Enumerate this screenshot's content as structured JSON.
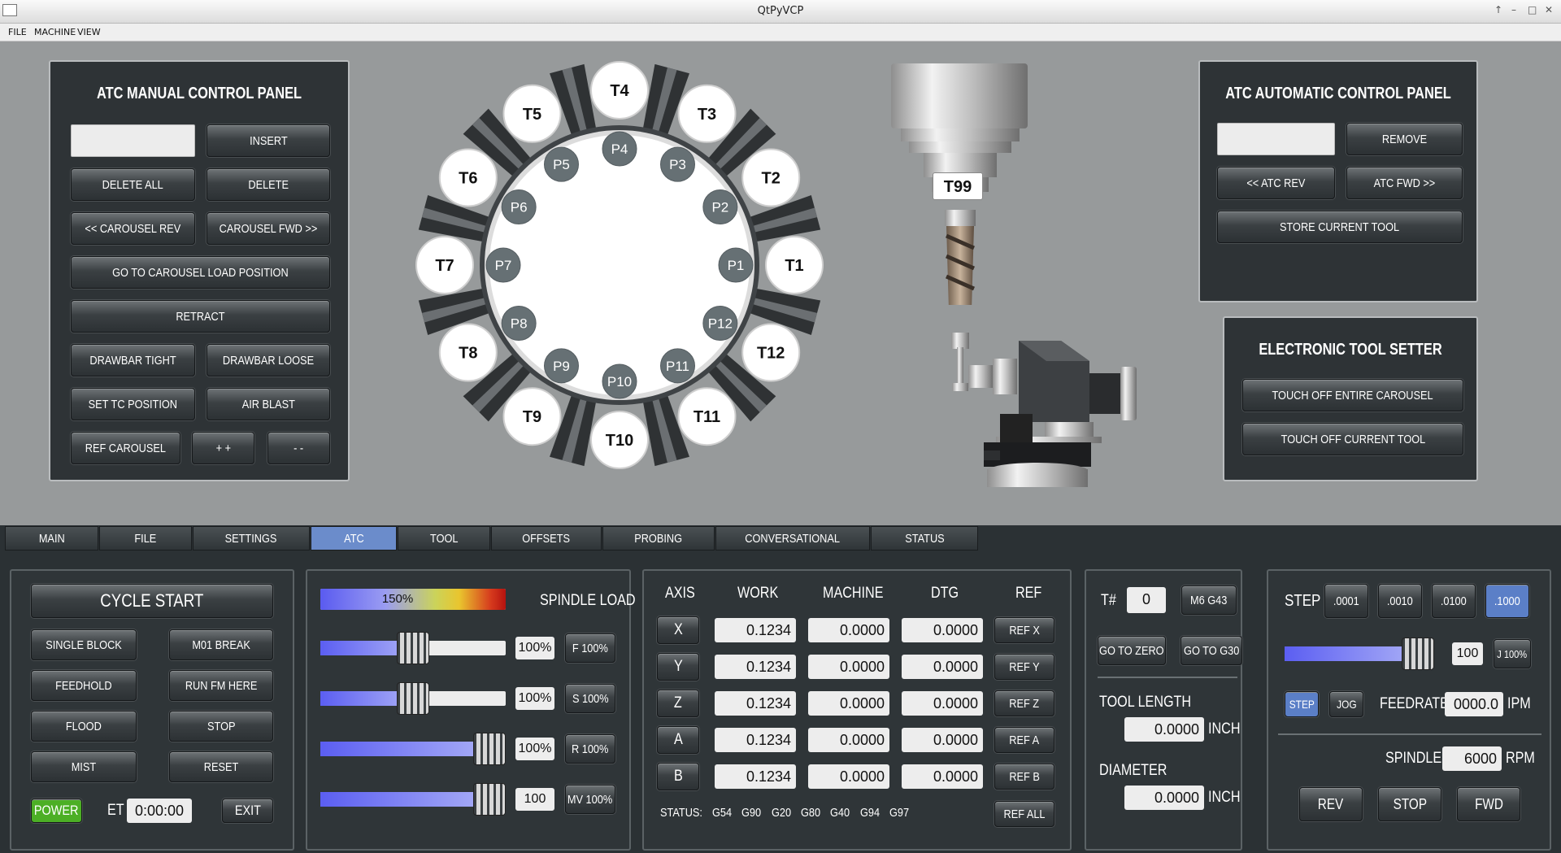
{
  "window": {
    "title": "QtPyVCP"
  },
  "menu": [
    "FILE",
    "MACHINE",
    "VIEW"
  ],
  "atc_manual": {
    "title": "ATC MANUAL CONTROL PANEL",
    "insert": "INSERT",
    "delete_all": "DELETE ALL",
    "delete": "DELETE",
    "carousel_rev": "<< CAROUSEL REV",
    "carousel_fwd": "CAROUSEL FWD >>",
    "go_load": "GO TO CAROUSEL LOAD POSITION",
    "retract": "RETRACT",
    "drawbar_tight": "DRAWBAR TIGHT",
    "drawbar_loose": "DRAWBAR LOOSE",
    "set_tc": "SET TC POSITION",
    "air_blast": "AIR BLAST",
    "ref_carousel": "REF CAROUSEL",
    "plus": "+ +",
    "minus": "- -"
  },
  "carousel": {
    "tools": [
      "T1",
      "T2",
      "T3",
      "T4",
      "T5",
      "T6",
      "T7",
      "T8",
      "T9",
      "T10",
      "T11",
      "T12"
    ],
    "pockets": [
      "P1",
      "P2",
      "P3",
      "P4",
      "P5",
      "P6",
      "P7",
      "P8",
      "P9",
      "P10",
      "P11",
      "P12"
    ],
    "spindle_tool": "T99"
  },
  "atc_auto": {
    "title": "ATC AUTOMATIC CONTROL PANEL",
    "remove": "REMOVE",
    "atc_rev": "<< ATC REV",
    "atc_fwd": "ATC FWD >>",
    "store": "STORE CURRENT TOOL"
  },
  "tool_setter": {
    "title": "ELECTRONIC TOOL SETTER",
    "touch_carousel": "TOUCH OFF ENTIRE CAROUSEL",
    "touch_current": "TOUCH OFF CURRENT TOOL"
  },
  "tabs": [
    {
      "label": "MAIN"
    },
    {
      "label": "FILE"
    },
    {
      "label": "SETTINGS"
    },
    {
      "label": "ATC",
      "active": true
    },
    {
      "label": "TOOL"
    },
    {
      "label": "OFFSETS"
    },
    {
      "label": "PROBING"
    },
    {
      "label": "CONVERSATIONAL"
    },
    {
      "label": "STATUS"
    }
  ],
  "program": {
    "cycle_start": "CYCLE START",
    "single_block": "SINGLE BLOCK",
    "m01_break": "M01 BREAK",
    "feedhold": "FEEDHOLD",
    "run_from_here": "RUN FM HERE",
    "flood": "FLOOD",
    "stop": "STOP",
    "mist": "MIST",
    "reset": "RESET",
    "power": "POWER",
    "et_label": "ET",
    "et_value": "0:00:00",
    "exit": "EXIT",
    "power_color": "#4caf25"
  },
  "overrides": {
    "spindle_load_label": "SPINDLE LOAD",
    "spindle_load_value": "150%",
    "spindle_load_fraction": 1.0,
    "feed": {
      "value": "100%",
      "button": "F 100%",
      "fraction": 0.5
    },
    "spindle": {
      "value": "100%",
      "button": "S 100%",
      "fraction": 0.5
    },
    "rapid": {
      "value": "100%",
      "button": "R 100%",
      "fraction": 1.0
    },
    "max_velocity": {
      "value": "100",
      "button": "MV 100%",
      "fraction": 1.0
    }
  },
  "dro": {
    "headers": [
      "AXIS",
      "WORK",
      "MACHINE",
      "DTG",
      "REF"
    ],
    "rows": [
      {
        "axis": "X",
        "work": "0.1234",
        "machine": "0.0000",
        "dtg": "0.0000",
        "ref": "REF X"
      },
      {
        "axis": "Y",
        "work": "0.1234",
        "machine": "0.0000",
        "dtg": "0.0000",
        "ref": "REF Y"
      },
      {
        "axis": "Z",
        "work": "0.1234",
        "machine": "0.0000",
        "dtg": "0.0000",
        "ref": "REF Z"
      },
      {
        "axis": "A",
        "work": "0.1234",
        "machine": "0.0000",
        "dtg": "0.0000",
        "ref": "REF A"
      },
      {
        "axis": "B",
        "work": "0.1234",
        "machine": "0.0000",
        "dtg": "0.0000",
        "ref": "REF B"
      }
    ],
    "status_label": "STATUS:",
    "gcodes": [
      "G54",
      "G90",
      "G20",
      "G80",
      "G40",
      "G94",
      "G97"
    ],
    "ref_all": "REF ALL"
  },
  "tool_panel": {
    "tnum_label": "T#",
    "tnum_value": "0",
    "m6g43": "M6 G43",
    "go_zero": "GO TO ZERO",
    "go_g30": "GO TO G30",
    "tool_length_label": "TOOL LENGTH",
    "tool_length_value": "0.0000",
    "diameter_label": "DIAMETER",
    "diameter_value": "0.0000",
    "unit": "INCH"
  },
  "jog": {
    "step_label": "STEP",
    "steps": [
      ".0001",
      ".0010",
      ".0100",
      ".1000"
    ],
    "active_step": 3,
    "jog_value": "100",
    "jog_button": "J 100%",
    "jog_fraction": 0.9,
    "step_mode": "STEP",
    "jog_mode": "JOG",
    "feedrate_label": "FEEDRATE",
    "feedrate_value": "0000.0",
    "feedrate_unit": "IPM",
    "spindle_label": "SPINDLE",
    "spindle_value": "6000",
    "spindle_unit": "RPM",
    "rev": "REV",
    "stop": "STOP",
    "fwd": "FWD",
    "accent": "#5b7fc7"
  }
}
